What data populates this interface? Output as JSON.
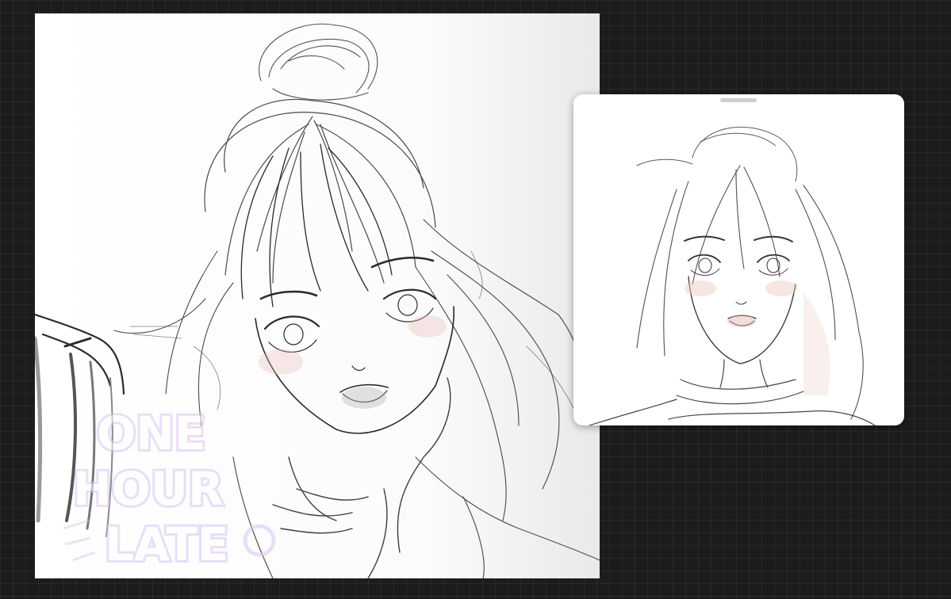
{
  "canvas": {
    "background": "#ffffff",
    "stroke_color": "#2a2a2a"
  },
  "reference_panel": {
    "background": "#ffffff",
    "handle_color": "#cfcfcf"
  },
  "watermark": {
    "line1": "ONE",
    "line2": "HOUR",
    "line3": "LATE",
    "color": "#d9c6f0"
  },
  "workspace": {
    "background": "#1c1c1c"
  }
}
